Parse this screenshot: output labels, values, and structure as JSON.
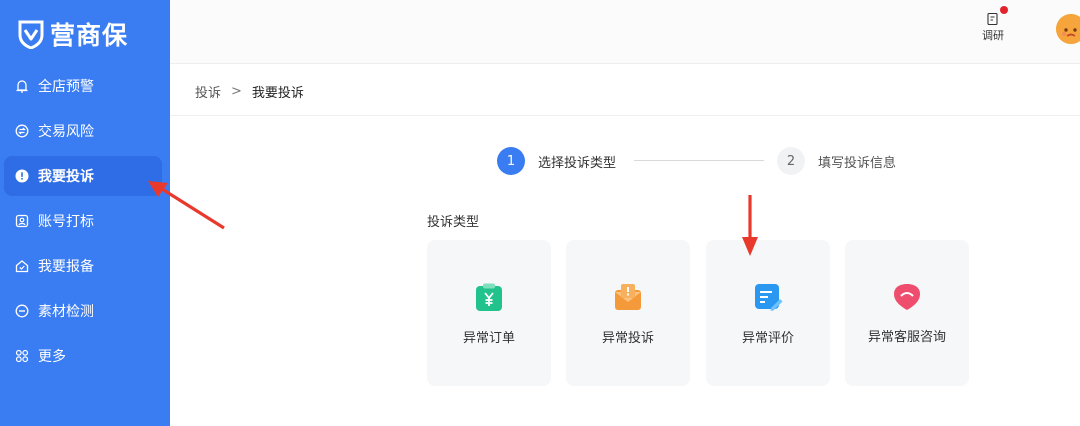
{
  "app": {
    "logo_text": "营商保"
  },
  "sidebar": {
    "items": [
      {
        "label": "全店预警",
        "icon": "bell-icon",
        "active": false
      },
      {
        "label": "交易风险",
        "icon": "exchange-icon",
        "active": false
      },
      {
        "label": "我要投诉",
        "icon": "alert-icon",
        "active": true
      },
      {
        "label": "账号打标",
        "icon": "tag-icon",
        "active": false
      },
      {
        "label": "我要报备",
        "icon": "home-check-icon",
        "active": false
      },
      {
        "label": "素材检测",
        "icon": "scan-icon",
        "active": false
      },
      {
        "label": "更多",
        "icon": "grid-icon",
        "active": false
      }
    ]
  },
  "header": {
    "survey_label": "调研",
    "survey_has_notification": true
  },
  "breadcrumb": {
    "parent": "投诉",
    "separator": ">",
    "current": "我要投诉"
  },
  "steps": [
    {
      "number": "1",
      "label": "选择投诉类型",
      "active": true
    },
    {
      "number": "2",
      "label": "填写投诉信息",
      "active": false
    }
  ],
  "complaint_types": {
    "title": "投诉类型",
    "items": [
      {
        "label": "异常订单",
        "icon": "order-clipboard-icon",
        "color": "#22c28d"
      },
      {
        "label": "异常投诉",
        "icon": "complaint-envelope-icon",
        "color": "#f59a3a"
      },
      {
        "label": "异常评价",
        "icon": "review-edit-icon",
        "color": "#2a98f0"
      },
      {
        "label": "异常客服咨询",
        "icon": "service-chat-icon",
        "color": "#ef4d6e"
      }
    ]
  },
  "colors": {
    "sidebar_bg": "#3a7cf2",
    "accent": "#3a7cf2",
    "annotation_arrow": "#e8392c"
  }
}
